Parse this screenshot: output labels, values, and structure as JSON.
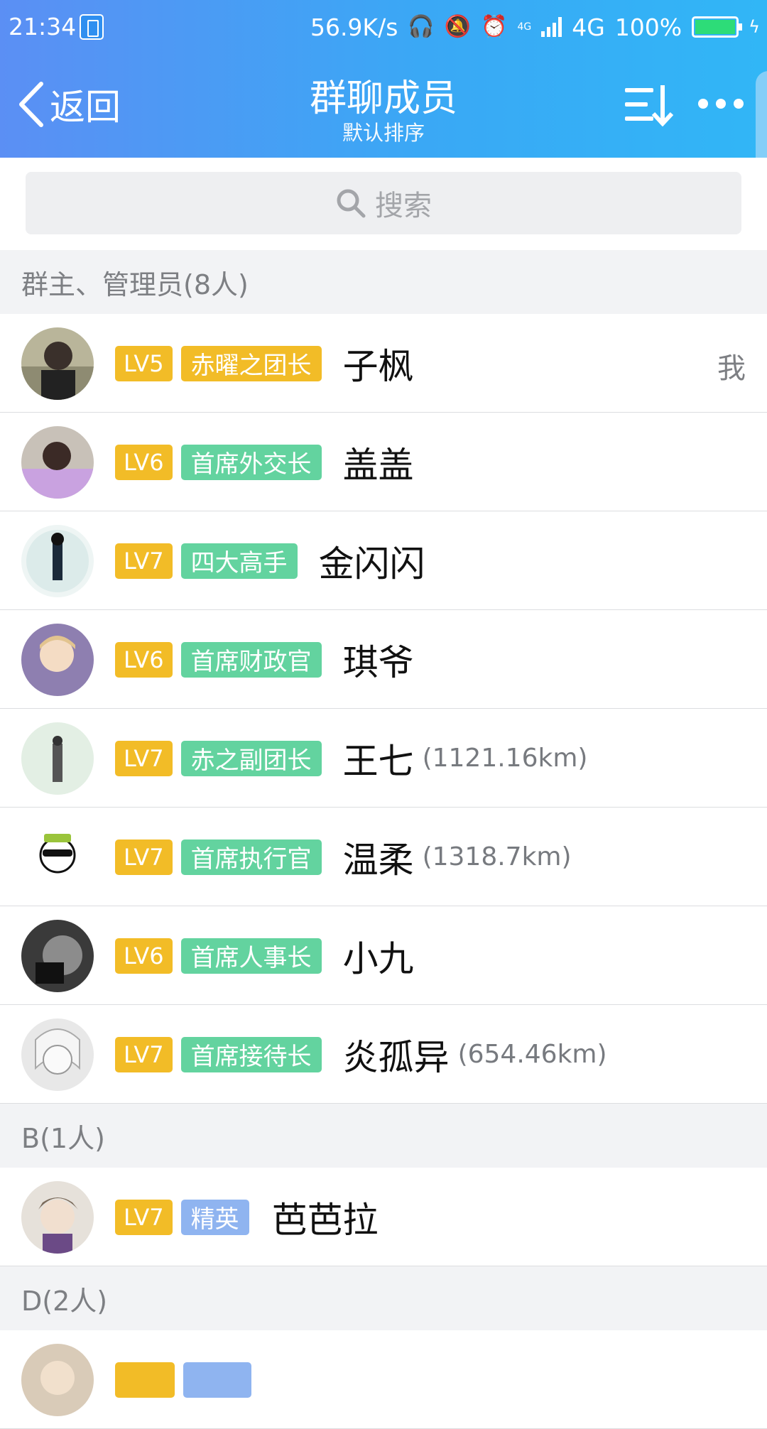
{
  "status_bar": {
    "time": "21:34",
    "speed": "56.9K/s",
    "network_small": "4G",
    "network": "4G",
    "battery": "100%"
  },
  "nav": {
    "back_label": "返回",
    "title": "群聊成员",
    "subtitle": "默认排序"
  },
  "search": {
    "placeholder": "搜索"
  },
  "sections": [
    {
      "header": "群主、管理员(8人)",
      "members": [
        {
          "level": "LV5",
          "title": "赤曜之团长",
          "title_color": "gold",
          "name": "子枫",
          "distance": "",
          "tag": "我"
        },
        {
          "level": "LV6",
          "title": "首席外交长",
          "title_color": "green",
          "name": "盖盖",
          "distance": "",
          "tag": ""
        },
        {
          "level": "LV7",
          "title": "四大高手",
          "title_color": "green",
          "name": "金闪闪",
          "distance": "",
          "tag": ""
        },
        {
          "level": "LV6",
          "title": "首席财政官",
          "title_color": "green",
          "name": "琪爷",
          "distance": "",
          "tag": ""
        },
        {
          "level": "LV7",
          "title": "赤之副团长",
          "title_color": "green",
          "name": "王七",
          "distance": "(1121.16km)",
          "tag": ""
        },
        {
          "level": "LV7",
          "title": "首席执行官",
          "title_color": "green",
          "name": "温柔",
          "distance": "(1318.7km)",
          "tag": ""
        },
        {
          "level": "LV6",
          "title": "首席人事长",
          "title_color": "green",
          "name": "小九",
          "distance": "",
          "tag": ""
        },
        {
          "level": "LV7",
          "title": "首席接待长",
          "title_color": "green",
          "name": "炎孤异",
          "distance": "(654.46km)",
          "tag": ""
        }
      ]
    },
    {
      "header": "B(1人)",
      "members": [
        {
          "level": "LV7",
          "title": "精英",
          "title_color": "blue",
          "name": "芭芭拉",
          "distance": "",
          "tag": ""
        }
      ]
    },
    {
      "header": "D(2人)",
      "members": []
    }
  ],
  "colors": {
    "header_gradient_start": "#5b8ff4",
    "header_gradient_end": "#31b6f6",
    "level_badge": "#f2bc27",
    "title_gold": "#f2bc27",
    "title_green": "#63d39f",
    "title_blue": "#8fb4f0"
  },
  "icons": {
    "back": "chevron-left-icon",
    "sort": "sort-list-icon",
    "more": "more-dots-icon",
    "search": "search-icon"
  }
}
